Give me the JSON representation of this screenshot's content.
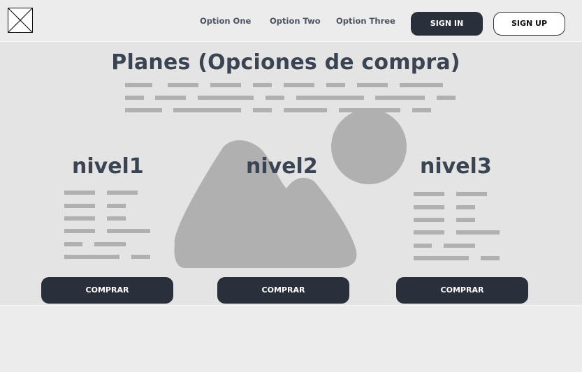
{
  "header": {
    "nav": [
      "Option One",
      "Option Two",
      "Option Three"
    ],
    "sign_in": "SIGN IN",
    "sign_up": "SIGN UP"
  },
  "main": {
    "title": "Planes (Opciones de compra)",
    "plans": [
      {
        "name": "nivel1",
        "button": "COMPRAR"
      },
      {
        "name": "nivel2",
        "button": "COMPRAR"
      },
      {
        "name": "nivel3",
        "button": "COMPRAR"
      }
    ]
  },
  "colors": {
    "dark": "#2a303b",
    "heading": "#3a4452",
    "placeholder": "#b0b0b0",
    "background": "#e4e4e4"
  },
  "icons": [
    "image-placeholder-icon",
    "image-placeholder-illustration"
  ]
}
